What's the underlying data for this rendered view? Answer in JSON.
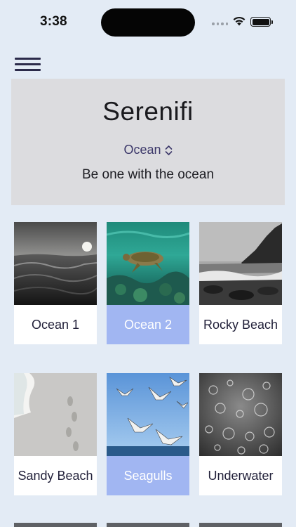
{
  "status": {
    "time": "3:38"
  },
  "header": {
    "title": "Serenifi",
    "category": "Ocean",
    "tagline": "Be one with the ocean"
  },
  "tiles": [
    {
      "label": "Ocean 1",
      "image": "ocean-waves-sunset",
      "selected": false
    },
    {
      "label": "Ocean 2",
      "image": "sea-turtle-underwater",
      "selected": true
    },
    {
      "label": "Rocky Beach",
      "image": "rocky-coastline",
      "selected": false
    },
    {
      "label": "Sandy Beach",
      "image": "footprints-in-sand",
      "selected": false
    },
    {
      "label": "Seagulls",
      "image": "flying-seagulls",
      "selected": true
    },
    {
      "label": "Underwater",
      "image": "underwater-bubbles",
      "selected": false
    }
  ],
  "colors": {
    "background": "#e3ebf5",
    "header_card": "#dcdcdf",
    "selected_label": "#a1b6f2",
    "accent": "#3b3769"
  }
}
